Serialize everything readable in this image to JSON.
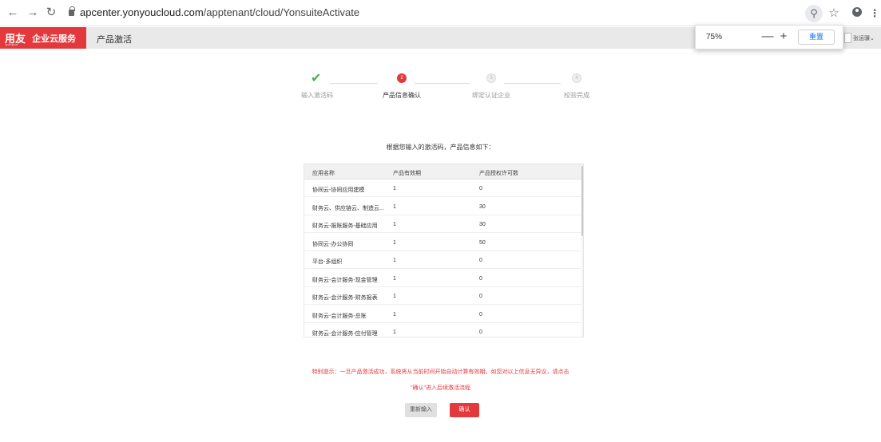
{
  "browser": {
    "url_host": "apcenter.yonyoucloud.com",
    "url_path": "/apptenant/cloud/YonsuiteActivate",
    "zoom_popup": {
      "value": "75%",
      "minus": "—",
      "plus": "+",
      "reset": "重置"
    }
  },
  "header": {
    "logo_main": "用友",
    "logo_sub": "yonyou",
    "logo_name": "企业云服务",
    "title": "产品激活",
    "user": "张运骥"
  },
  "steps": [
    {
      "label": "输入激活码",
      "state": "done",
      "number": "1"
    },
    {
      "label": "产品信息确认",
      "state": "active",
      "number": "2"
    },
    {
      "label": "绑定认证企业",
      "state": "pending",
      "number": "3"
    },
    {
      "label": "校验完成",
      "state": "pending",
      "number": "4"
    }
  ],
  "info_title": "根据您输入的激活码，产品信息如下：",
  "table": {
    "columns": [
      "应用名称",
      "产品有效期",
      "产品授权许可数"
    ],
    "rows": [
      [
        "协同云-协同应用建模",
        "1",
        "0"
      ],
      [
        "财务云、供应链云、制造云...",
        "1",
        "30"
      ],
      [
        "财务云-报账服务-基础应用",
        "1",
        "30"
      ],
      [
        "协同云-办公协同",
        "1",
        "50"
      ],
      [
        "平台-多组织",
        "1",
        "0"
      ],
      [
        "财务云-会计服务-现金管理",
        "1",
        "0"
      ],
      [
        "财务云-会计服务-财务报表",
        "1",
        "0"
      ],
      [
        "财务云-会计服务-总账",
        "1",
        "0"
      ],
      [
        "财务云-会计服务-应付管理",
        "1",
        "0"
      ]
    ]
  },
  "notice_line1": "特别提示：一旦产品激活成功，系统将从当前时间开始自动计算有效期。如您对以上信息无异议，请点击",
  "notice_line2": "\"确认\"进入后续激活流程",
  "buttons": {
    "reenter": "重新输入",
    "confirm": "确认"
  },
  "colors": {
    "brand": "#e4393c",
    "success": "#4caf50"
  }
}
